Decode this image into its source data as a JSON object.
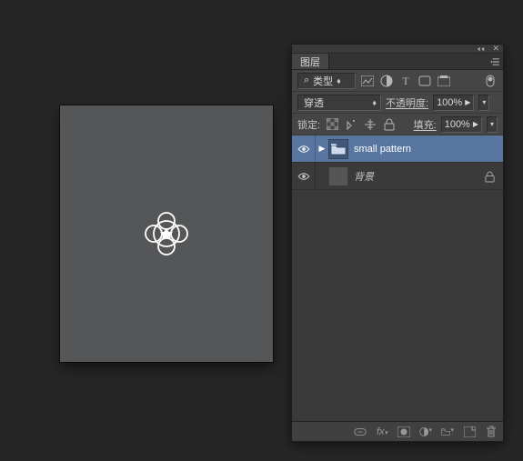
{
  "canvas": {},
  "panel": {
    "tab_title": "图层",
    "filter_kind": "类型",
    "blend_mode": "穿透",
    "opacity_label": "不透明度:",
    "opacity_value": "100%",
    "lock_label": "锁定:",
    "fill_label": "填充:",
    "fill_value": "100%"
  },
  "layers": [
    {
      "name": "small pattern",
      "is_group": true,
      "selected": true,
      "visible": true
    },
    {
      "name": "背景",
      "is_group": false,
      "selected": false,
      "visible": true,
      "locked": true
    }
  ]
}
